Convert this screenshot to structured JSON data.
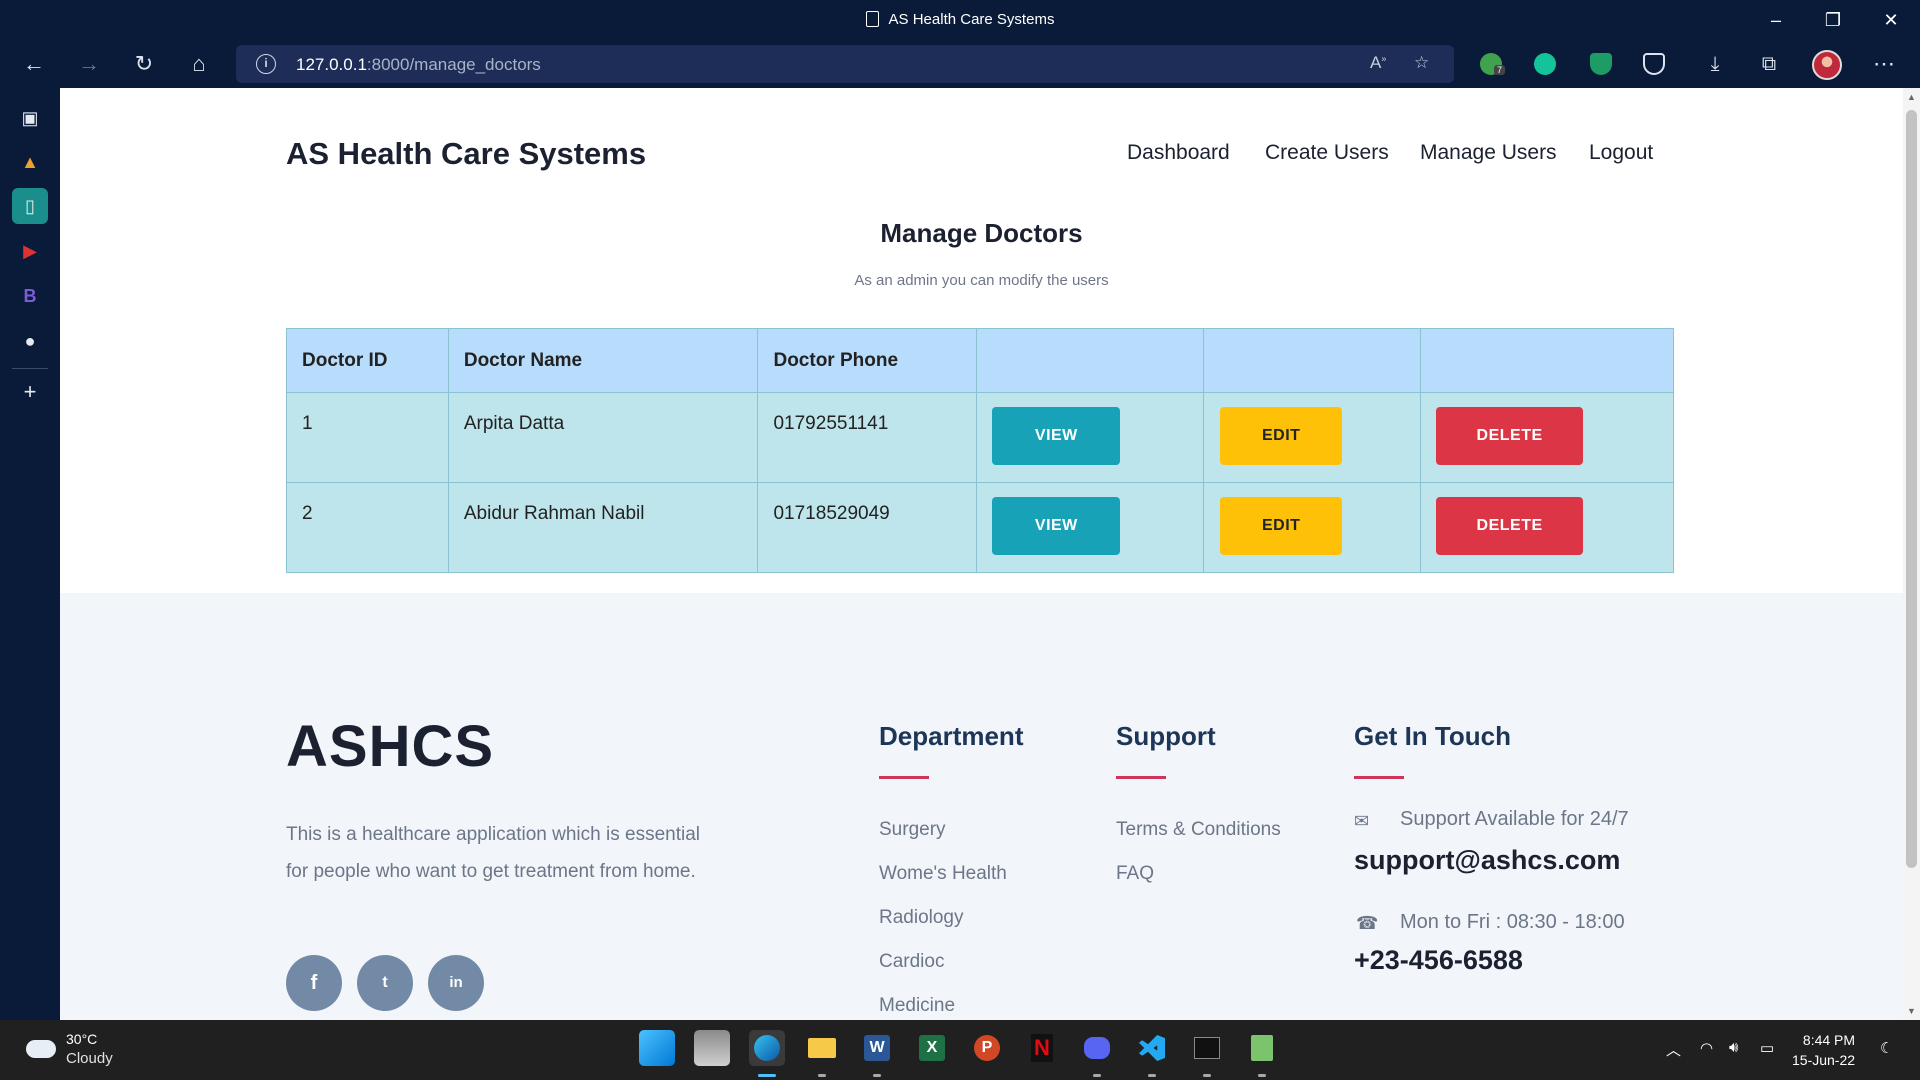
{
  "window": {
    "title": "AS Health Care Systems"
  },
  "browser": {
    "url_host": "127.0.0.1",
    "url_path": ":8000/manage_doctors",
    "extension_badge": "7"
  },
  "site": {
    "brand": "AS Health Care Systems",
    "nav": [
      "Dashboard",
      "Create Users",
      "Manage Users",
      "Logout"
    ]
  },
  "main": {
    "title": "Manage Doctors",
    "subtitle": "As an admin you can modify the users"
  },
  "table": {
    "headers": [
      "Doctor ID",
      "Doctor Name",
      "Doctor Phone",
      "",
      "",
      ""
    ],
    "rows": [
      {
        "id": "1",
        "name": "Arpita Datta",
        "phone": "01792551141"
      },
      {
        "id": "2",
        "name": "Abidur Rahman Nabil",
        "phone": "01718529049"
      }
    ],
    "actions": {
      "view": "VIEW",
      "edit": "EDIT",
      "delete": "DELETE"
    }
  },
  "footer": {
    "logo": "ASHCS",
    "description": "This is a healthcare application which is essential for people who want to get treatment from home.",
    "social": [
      "f",
      "t",
      "in"
    ],
    "department": {
      "heading": "Department",
      "links": [
        "Surgery",
        "Wome's Health",
        "Radiology",
        "Cardioc",
        "Medicine"
      ]
    },
    "support": {
      "heading": "Support",
      "links": [
        "Terms & Conditions",
        "FAQ"
      ]
    },
    "contact": {
      "heading": "Get In Touch",
      "availability": "Support Available for 24/7",
      "email": "support@ashcs.com",
      "hours": "Mon to Fri : 08:30 - 18:00",
      "phone": "+23-456-6588"
    }
  },
  "taskbar": {
    "weather_temp": "30°C",
    "weather_cond": "Cloudy",
    "time": "8:44 PM",
    "date": "15-Jun-22"
  },
  "colors": {
    "view": "#17a2b8",
    "edit": "#ffc107",
    "delete": "#dc3545",
    "accent_line": "#d1345b",
    "table_header": "#b8dcfb",
    "table_row": "#bee5eb"
  }
}
